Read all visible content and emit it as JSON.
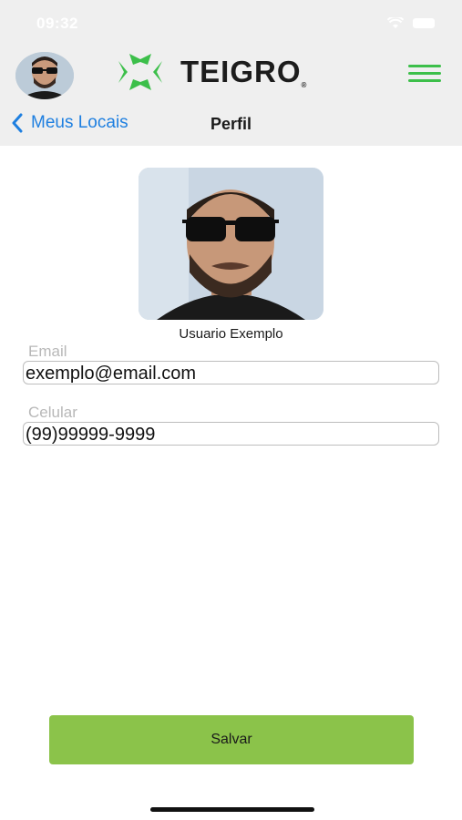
{
  "status_bar": {
    "time": "09:32"
  },
  "header": {
    "brand_name": "TEIGRO",
    "brand_mark": "®",
    "brand_color": "#3cbf4a",
    "back_label": "Meus Locais",
    "title": "Perfil"
  },
  "profile": {
    "name": "Usuario Exemplo"
  },
  "form": {
    "email_label": "Email",
    "email_value": "exemplo@email.com",
    "phone_label": "Celular",
    "phone_value": "(99)99999-9999",
    "save_label": "Salvar"
  },
  "icons": [
    "wifi-icon",
    "battery-icon",
    "teigro-logo-icon",
    "hamburger-menu-icon",
    "chevron-left-icon"
  ],
  "colors": {
    "accent_blue": "#1e7fe0",
    "save_green": "#8bc34a"
  }
}
